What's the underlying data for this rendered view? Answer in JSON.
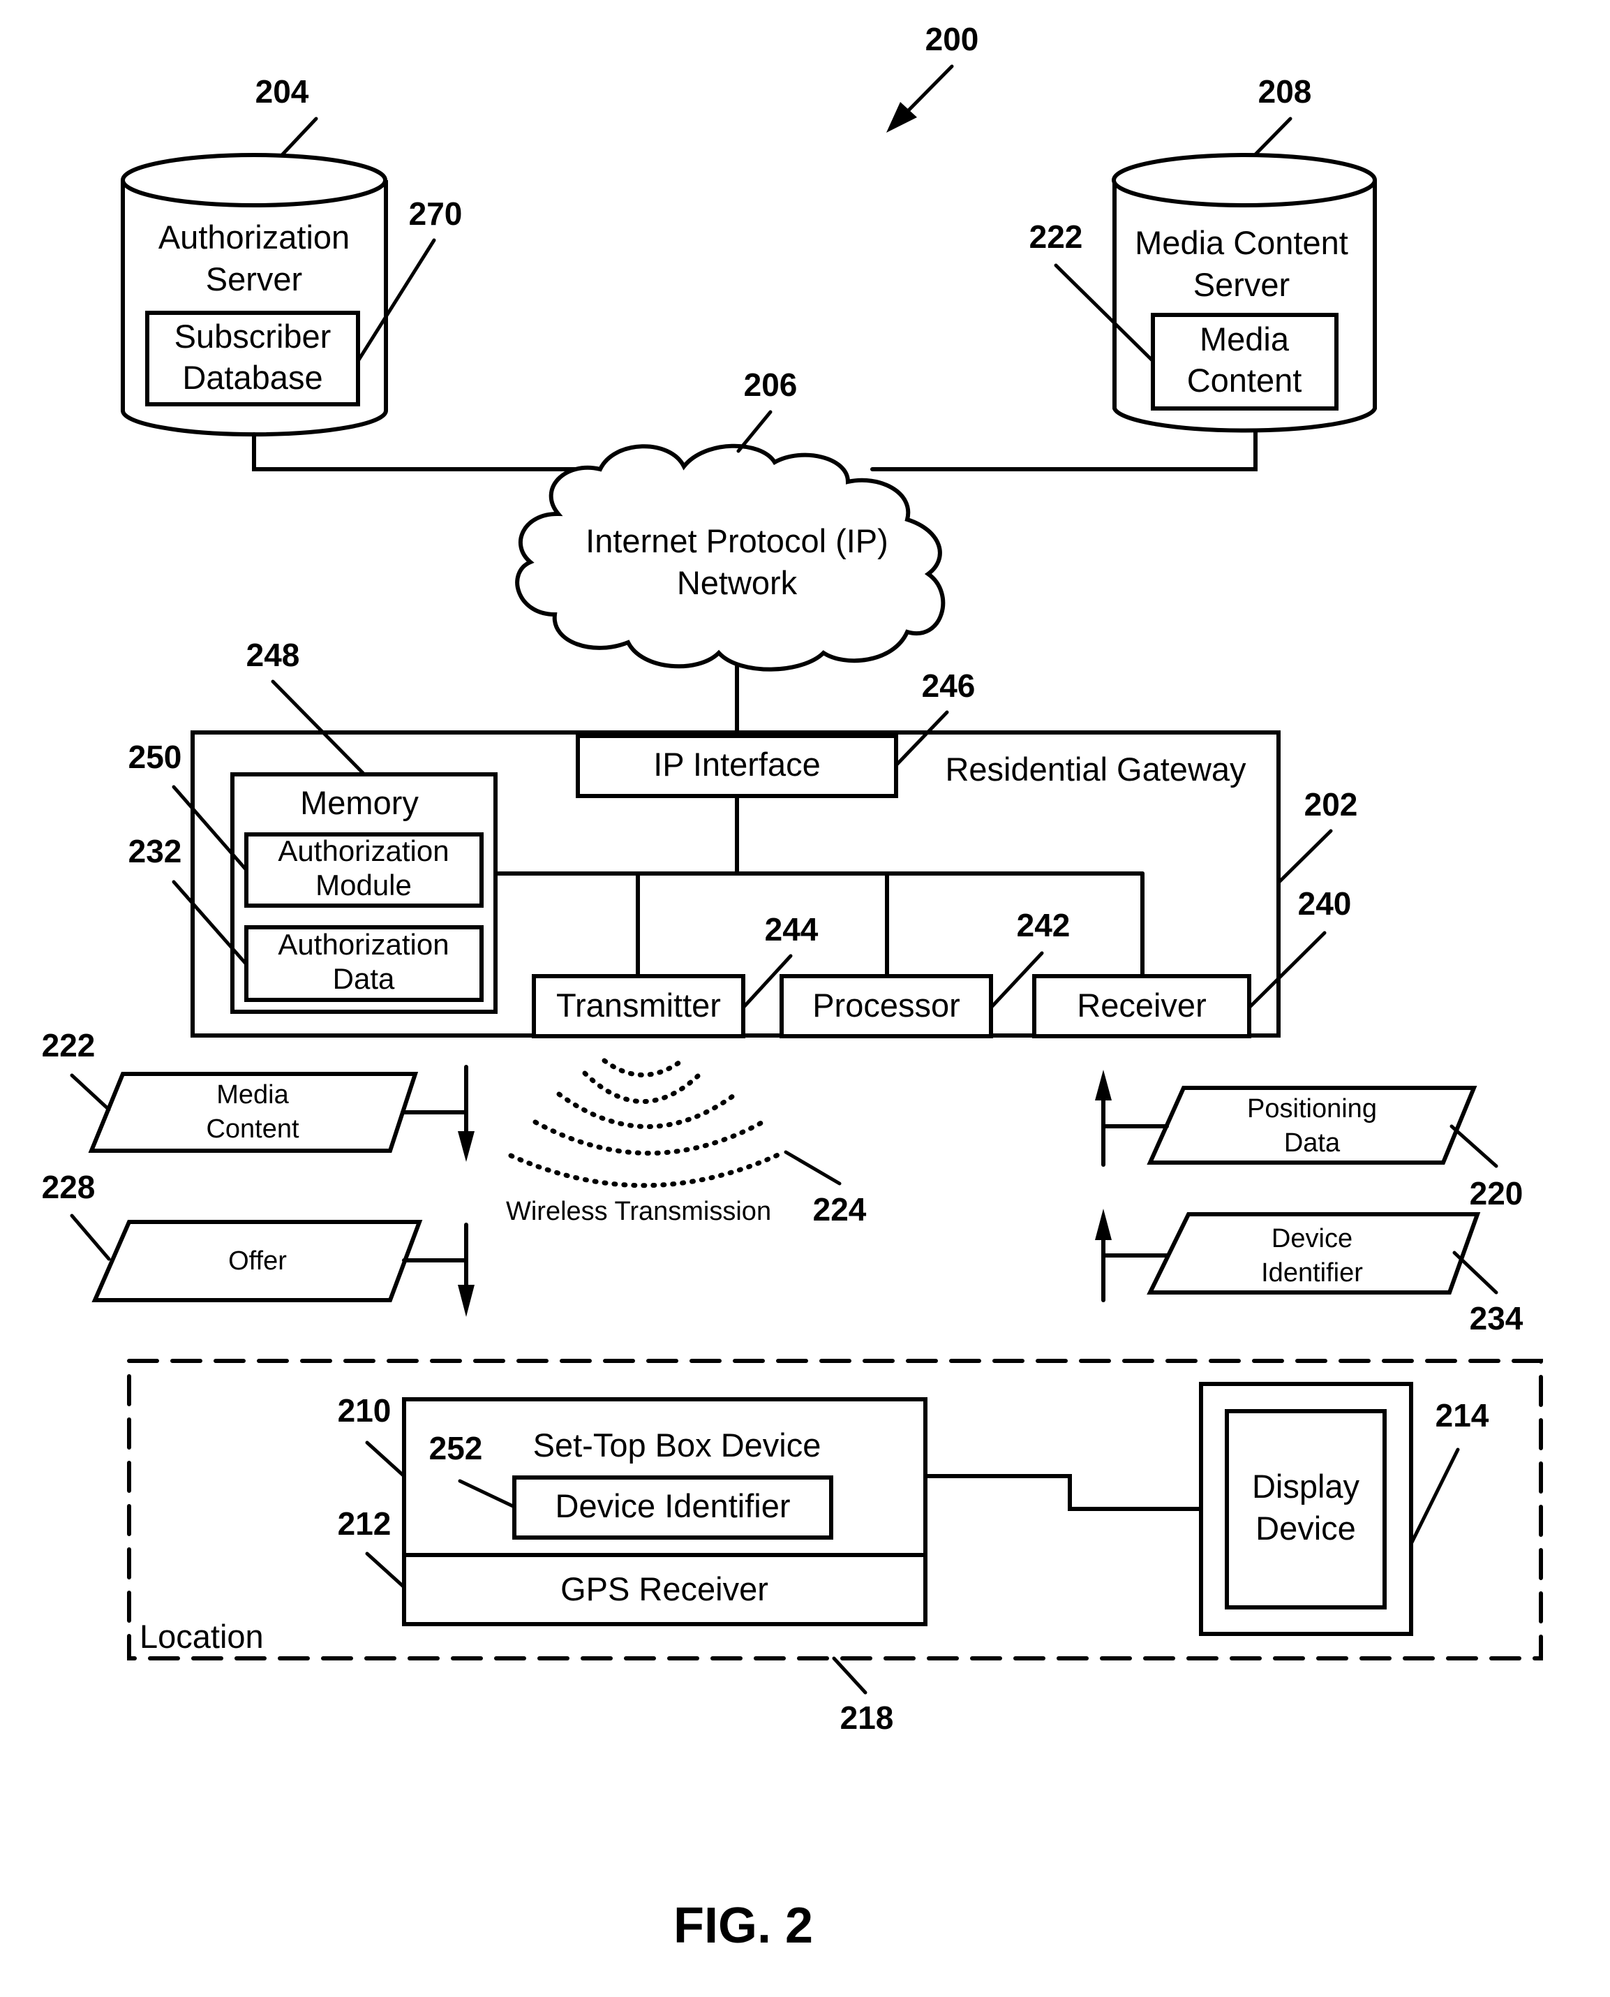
{
  "figure": {
    "caption": "FIG. 2",
    "system_ref": "200"
  },
  "authorization_server": {
    "ref": "204",
    "title_lines": [
      "Authorization",
      "Server"
    ],
    "subscriber_database": {
      "ref": "270",
      "lines": [
        "Subscriber",
        "Database"
      ]
    }
  },
  "media_content_server": {
    "ref": "208",
    "title_lines": [
      "Media Content",
      "Server"
    ],
    "media_content": {
      "ref": "222",
      "lines": [
        "Media",
        "Content"
      ]
    }
  },
  "ip_network": {
    "ref": "206",
    "lines": [
      "Internet Protocol (IP)",
      "Network"
    ]
  },
  "residential_gateway": {
    "ref": "202",
    "title": "Residential Gateway",
    "ip_interface": {
      "ref": "246",
      "label": "IP Interface"
    },
    "memory": {
      "ref": "248",
      "label": "Memory",
      "authorization_module": {
        "ref": "250",
        "lines": [
          "Authorization",
          "Module"
        ]
      },
      "authorization_data": {
        "ref": "232",
        "lines": [
          "Authorization",
          "Data"
        ]
      }
    },
    "transmitter": {
      "ref": "244",
      "label": "Transmitter"
    },
    "processor": {
      "ref": "242",
      "label": "Processor"
    },
    "receiver": {
      "ref": "240",
      "label": "Receiver"
    }
  },
  "data_flows": {
    "downstream": [
      {
        "ref": "222",
        "lines": [
          "Media",
          "Content"
        ],
        "direction": "down"
      },
      {
        "ref": "228",
        "lines": [
          "Offer"
        ],
        "direction": "down"
      }
    ],
    "upstream": [
      {
        "ref": "220",
        "lines": [
          "Positioning",
          "Data"
        ],
        "direction": "up"
      },
      {
        "ref": "234",
        "lines": [
          "Device",
          "Identifier"
        ],
        "direction": "up"
      }
    ],
    "wireless": {
      "ref": "224",
      "label": "Wireless Transmission",
      "arc_count": 5
    }
  },
  "location": {
    "ref": "218",
    "label": "Location",
    "set_top_box": {
      "ref": "210",
      "title": "Set-Top Box Device",
      "device_identifier": {
        "ref": "252",
        "label": "Device Identifier"
      },
      "gps_receiver": {
        "ref": "212",
        "label": "GPS Receiver"
      }
    },
    "display_device": {
      "ref": "214",
      "lines": [
        "Display",
        "Device"
      ]
    }
  }
}
